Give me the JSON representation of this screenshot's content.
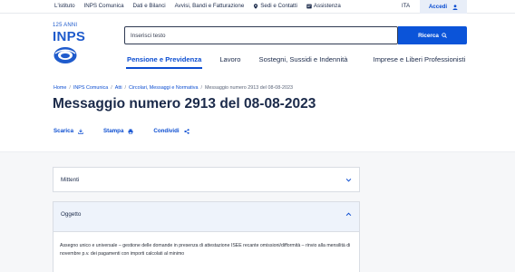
{
  "topbar": {
    "links": [
      {
        "label": "L'istituto",
        "icon": ""
      },
      {
        "label": "INPS Comunica",
        "icon": ""
      },
      {
        "label": "Dati e Bilanci",
        "icon": ""
      },
      {
        "label": "Avvisi, Bandi e Fatturazione",
        "icon": ""
      },
      {
        "label": "Sedi e Contatti",
        "icon": "location-pin-icon"
      },
      {
        "label": "Assistenza",
        "icon": "assistance-icon"
      }
    ],
    "language": "ITA",
    "login_label": "Accedi"
  },
  "logo": {
    "years": "125 ANNI",
    "word": "INPS"
  },
  "search": {
    "placeholder": "Inserisci testo",
    "value": "",
    "button_label": "Ricerca"
  },
  "nav": {
    "items": [
      {
        "label": "Pensione e Previdenza",
        "active": true
      },
      {
        "label": "Lavoro",
        "active": false
      },
      {
        "label": "Sostegni, Sussidi e Indennità",
        "active": false
      },
      {
        "label": "Imprese e Liberi Professionisti",
        "active": false
      }
    ]
  },
  "breadcrumb": {
    "items": [
      "Home",
      "INPS Comunica",
      "Atti",
      "Circolari, Messaggi e Normativa",
      "Messaggio numero 2913 del 08-08-2023"
    ],
    "separator": "/"
  },
  "page": {
    "title": "Messaggio numero 2913 del 08-08-2023"
  },
  "actions": {
    "download": "Scarica",
    "print": "Stampa",
    "share": "Condividi"
  },
  "accordions": {
    "mittenti": {
      "title": "Mittenti",
      "expanded": false
    },
    "oggetto": {
      "title": "Oggetto",
      "expanded": true,
      "text": "Assegno unico e universale – gestione delle domande in presenza di attestazione ISEE recante omissioni/difformità – rinvio alla mensilità di novembre p.v. dei pagamenti con importi calcolati al minimo"
    }
  },
  "colors": {
    "brand_blue": "#0b54d9",
    "text_dark": "#1b2a4a",
    "login_bg": "#e8eef8"
  }
}
